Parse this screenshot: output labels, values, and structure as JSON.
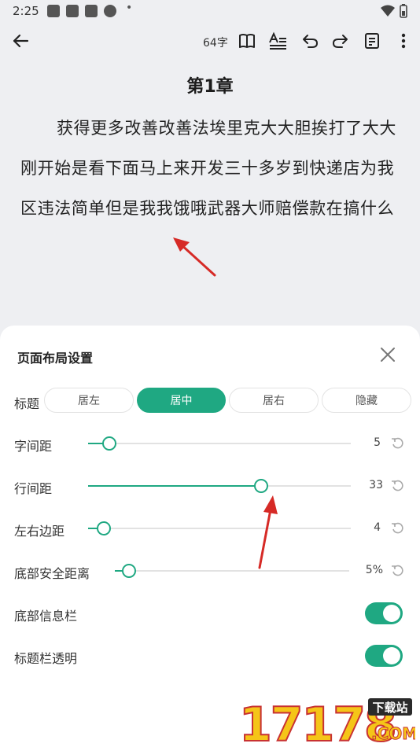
{
  "status_bar": {
    "time": "2:25",
    "dot": "•"
  },
  "toolbar": {
    "back_icon": "arrow-left-icon",
    "word_count": "64字",
    "icons": [
      "book-icon",
      "text-format-icon",
      "undo-icon",
      "redo-icon",
      "note-icon",
      "more-vert-icon"
    ]
  },
  "chapter": {
    "title": "第1章",
    "body": "获得更多改善改善法埃里克大大胆挨打了大大刚开始是看下面马上来开发三十多岁到快递店为我区违法简单但是我我饿哦武器大师赔偿款在搞什么"
  },
  "sheet": {
    "title": "页面布局设置",
    "title_row": {
      "label": "标题",
      "options": [
        "居左",
        "居中",
        "居右",
        "隐藏"
      ],
      "selected": "居中"
    },
    "sliders": [
      {
        "label": "字间距",
        "value": "5",
        "level": 0.08
      },
      {
        "label": "行间距",
        "value": "33",
        "level": 0.66
      },
      {
        "label": "左右边距",
        "value": "4",
        "level": 0.06
      },
      {
        "label": "底部安全距离",
        "value": "5%",
        "level": 0.06
      }
    ],
    "toggles": [
      {
        "label": "底部信息栏",
        "on": true
      },
      {
        "label": "标题栏透明",
        "on": true
      }
    ]
  },
  "watermark": {
    "text": "17178",
    "badge": "下载站",
    "suffix": ".COM"
  },
  "colors": {
    "accent": "#1fa882",
    "arrow": "#d62a26",
    "background": "#eeeff2"
  }
}
